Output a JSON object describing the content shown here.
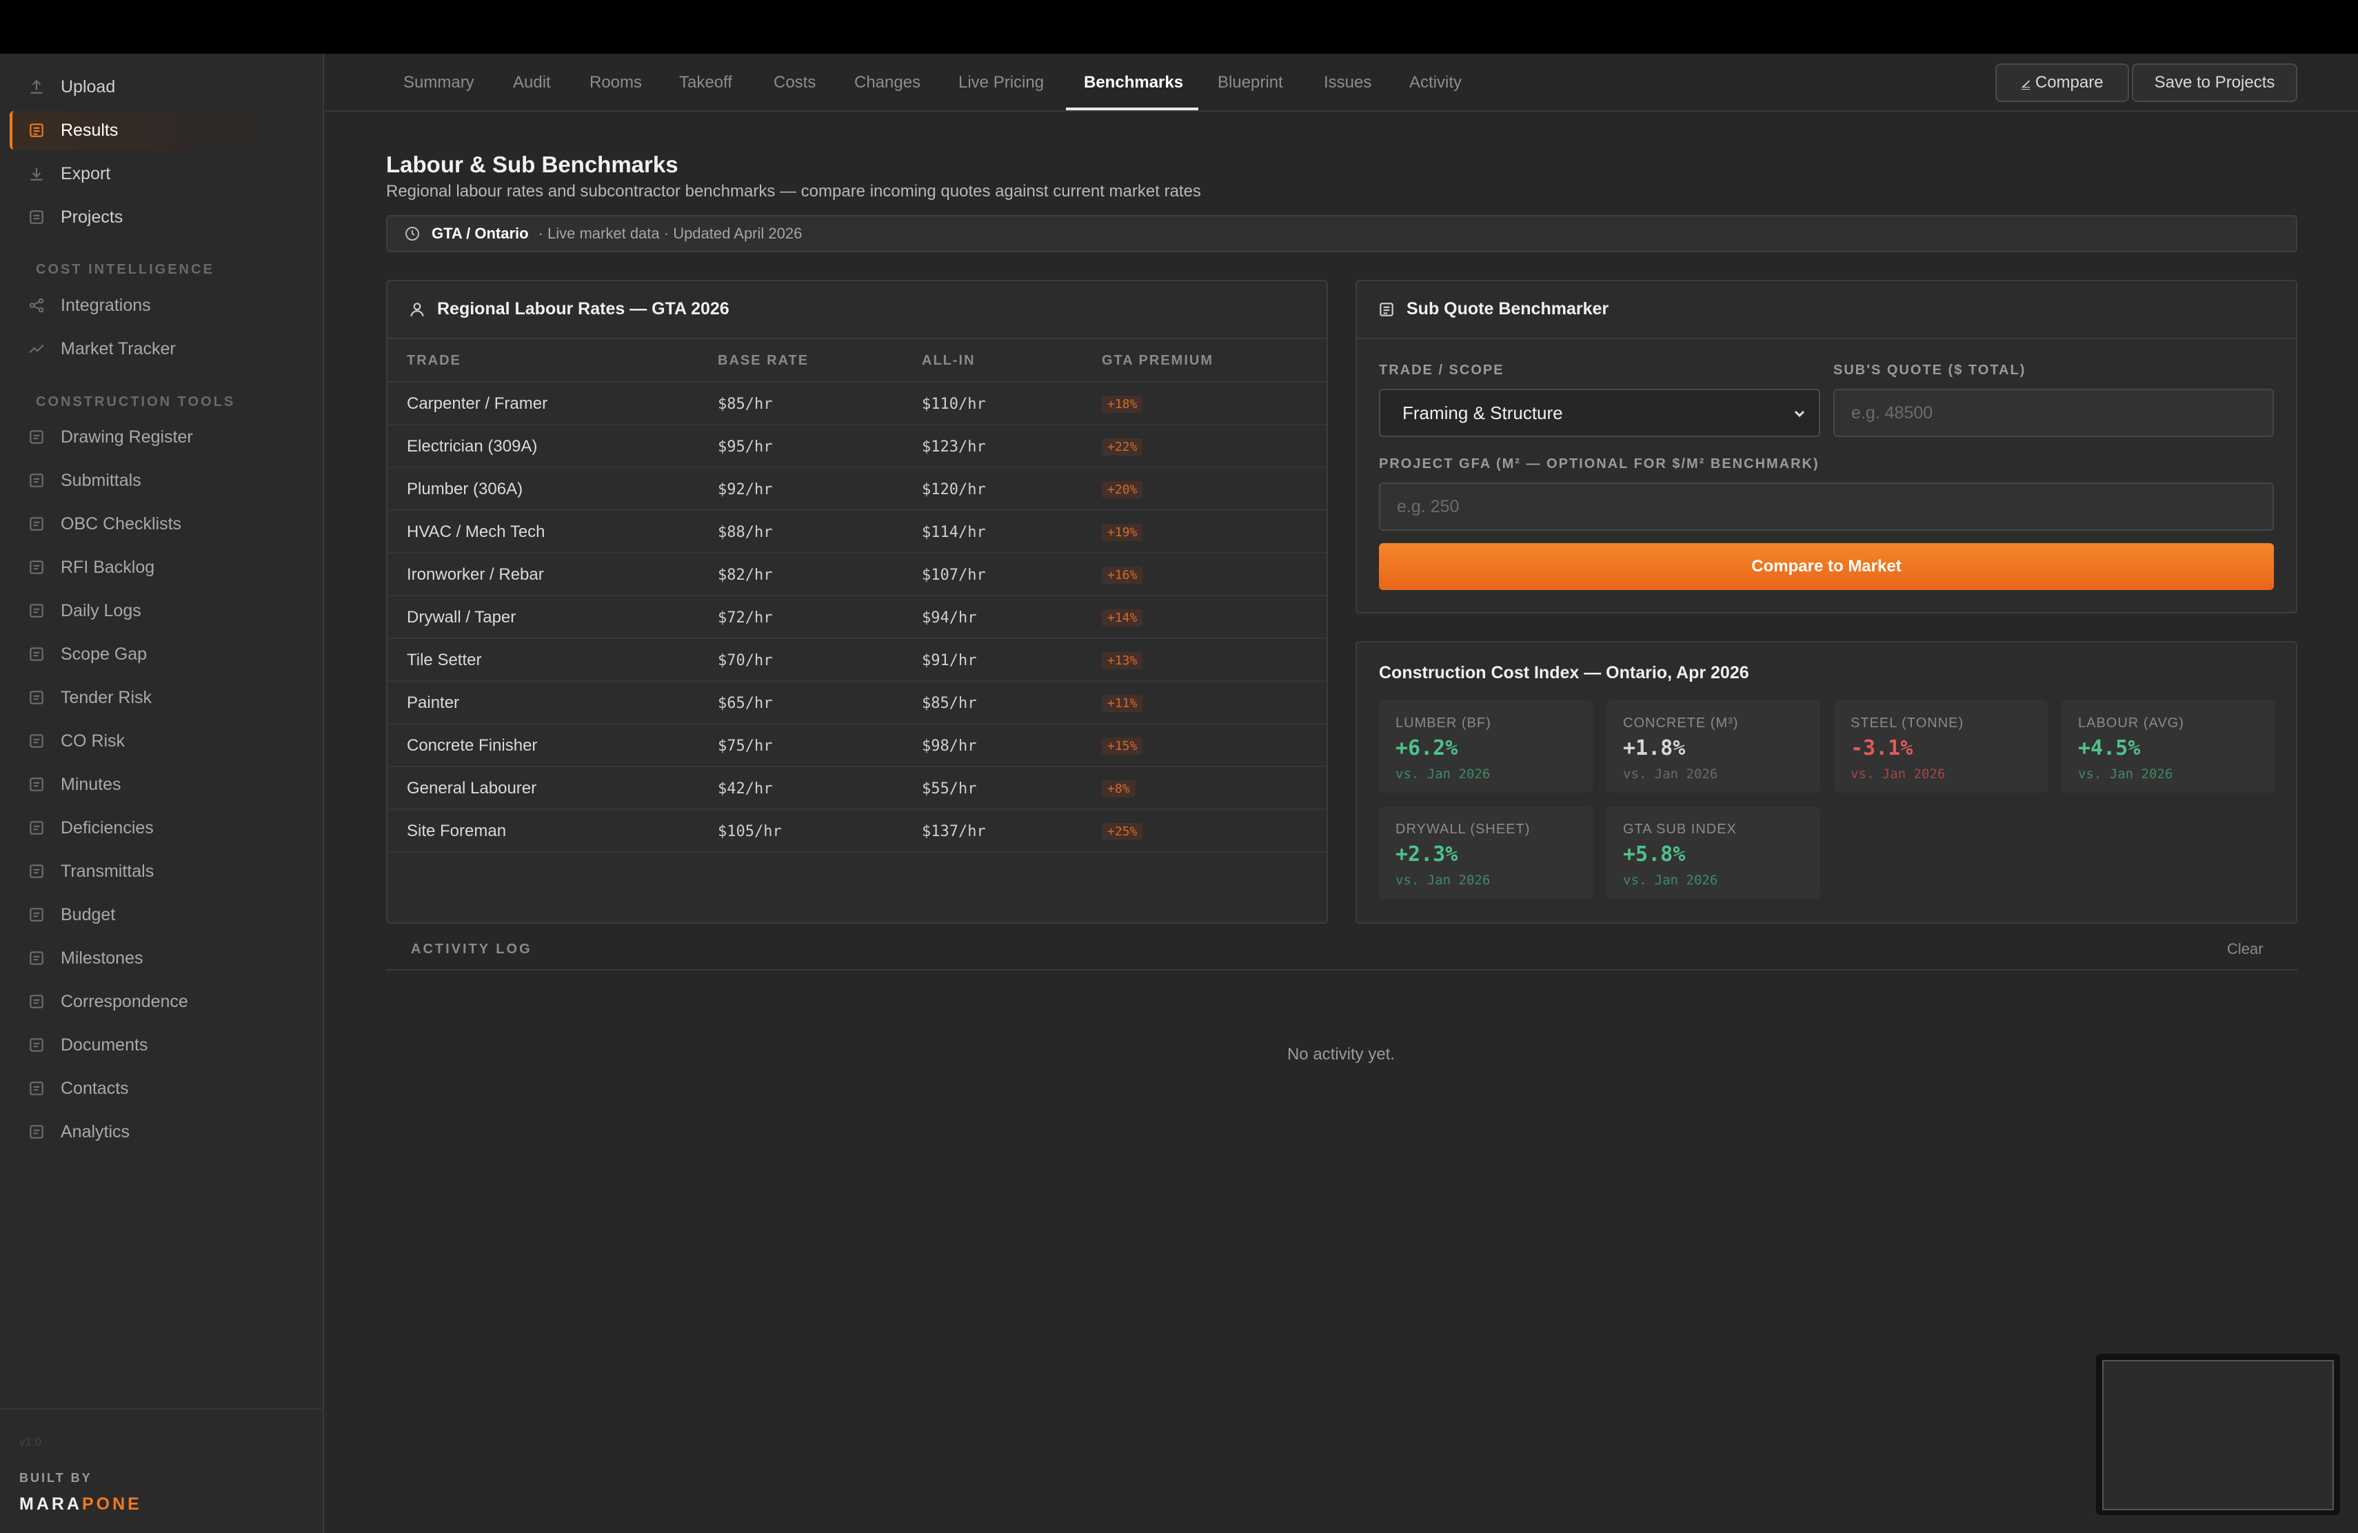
{
  "sidebar": {
    "primary_items": [
      {
        "label": "Upload",
        "icon": "upload-icon"
      },
      {
        "label": "Results",
        "icon": "results-icon",
        "active": true
      },
      {
        "label": "Export",
        "icon": "export-icon"
      },
      {
        "label": "Projects",
        "icon": "projects-icon"
      }
    ],
    "section_cost": "COST INTELLIGENCE",
    "cost_items": [
      {
        "label": "Integrations",
        "icon": "integrations-icon"
      },
      {
        "label": "Market Tracker",
        "icon": "trend-icon"
      }
    ],
    "section_tools": "CONSTRUCTION TOOLS",
    "tool_items": [
      {
        "label": "Drawing Register"
      },
      {
        "label": "Submittals"
      },
      {
        "label": "OBC Checklists"
      },
      {
        "label": "RFI Backlog"
      },
      {
        "label": "Daily Logs"
      },
      {
        "label": "Scope Gap"
      },
      {
        "label": "Tender Risk"
      },
      {
        "label": "CO Risk"
      },
      {
        "label": "Minutes"
      },
      {
        "label": "Deficiencies"
      },
      {
        "label": "Transmittals"
      },
      {
        "label": "Budget"
      },
      {
        "label": "Milestones"
      },
      {
        "label": "Correspondence"
      },
      {
        "label": "Documents"
      },
      {
        "label": "Contacts"
      },
      {
        "label": "Analytics"
      }
    ],
    "version": "v1.0",
    "built_by": "BUILT BY",
    "brand_a": "MARA",
    "brand_b": "PONE"
  },
  "tabs": [
    "Summary",
    "Audit",
    "Rooms",
    "Takeoff",
    "Costs",
    "Changes",
    "Live Pricing",
    "Benchmarks",
    "Blueprint",
    "Issues",
    "Activity"
  ],
  "active_tab": "Benchmarks",
  "header_buttons": {
    "compare": "⦤ Compare",
    "save": "Save to Projects"
  },
  "page": {
    "title": "Labour & Sub Benchmarks",
    "subtitle": "Regional labour rates and subcontractor benchmarks — compare incoming quotes against current market rates",
    "region": "GTA / Ontario",
    "region_meta": "· Live market data · Updated April 2026"
  },
  "labour": {
    "title": "Regional Labour Rates — GTA 2026",
    "columns": [
      "TRADE",
      "BASE RATE",
      "ALL-IN",
      "GTA PREMIUM"
    ],
    "rows": [
      [
        "Carpenter / Framer",
        "$85/hr",
        "$110/hr",
        "+18%"
      ],
      [
        "Electrician (309A)",
        "$95/hr",
        "$123/hr",
        "+22%"
      ],
      [
        "Plumber (306A)",
        "$92/hr",
        "$120/hr",
        "+20%"
      ],
      [
        "HVAC / Mech Tech",
        "$88/hr",
        "$114/hr",
        "+19%"
      ],
      [
        "Ironworker / Rebar",
        "$82/hr",
        "$107/hr",
        "+16%"
      ],
      [
        "Drywall / Taper",
        "$72/hr",
        "$94/hr",
        "+14%"
      ],
      [
        "Tile Setter",
        "$70/hr",
        "$91/hr",
        "+13%"
      ],
      [
        "Painter",
        "$65/hr",
        "$85/hr",
        "+11%"
      ],
      [
        "Concrete Finisher",
        "$75/hr",
        "$98/hr",
        "+15%"
      ],
      [
        "General Labourer",
        "$42/hr",
        "$55/hr",
        "+8%"
      ],
      [
        "Site Foreman",
        "$105/hr",
        "$137/hr",
        "+25%"
      ]
    ]
  },
  "benchmarker": {
    "title": "Sub Quote Benchmarker",
    "trade_label": "TRADE / SCOPE",
    "trade_value": "Framing & Structure",
    "quote_label": "SUB'S QUOTE ($ TOTAL)",
    "quote_placeholder": "e.g. 48500",
    "gfa_label": "PROJECT GFA (M² — OPTIONAL FOR $/M² BENCHMARK)",
    "gfa_placeholder": "e.g. 250",
    "button": "Compare to Market"
  },
  "cost_index": {
    "title": "Construction Cost Index — Ontario, Apr 2026",
    "tiles": [
      {
        "label": "LUMBER (BF)",
        "value": "+6.2%",
        "sub": "vs. Jan 2026",
        "trend": "up"
      },
      {
        "label": "CONCRETE (M³)",
        "value": "+1.8%",
        "sub": "vs. Jan 2026",
        "trend": "flat"
      },
      {
        "label": "STEEL (TONNE)",
        "value": "-3.1%",
        "sub": "vs. Jan 2026",
        "trend": "down"
      },
      {
        "label": "LABOUR (AVG)",
        "value": "+4.5%",
        "sub": "vs. Jan 2026",
        "trend": "up"
      },
      {
        "label": "DRYWALL (SHEET)",
        "value": "+2.3%",
        "sub": "vs. Jan 2026",
        "trend": "up"
      },
      {
        "label": "GTA SUB INDEX",
        "value": "+5.8%",
        "sub": "vs. Jan 2026",
        "trend": "up"
      }
    ]
  },
  "activity": {
    "label": "ACTIVITY LOG",
    "clear": "Clear",
    "empty": "No activity yet."
  },
  "colors": {
    "accent": "#f07a22",
    "positive": "#4cc38a",
    "negative": "#e05a5a"
  }
}
